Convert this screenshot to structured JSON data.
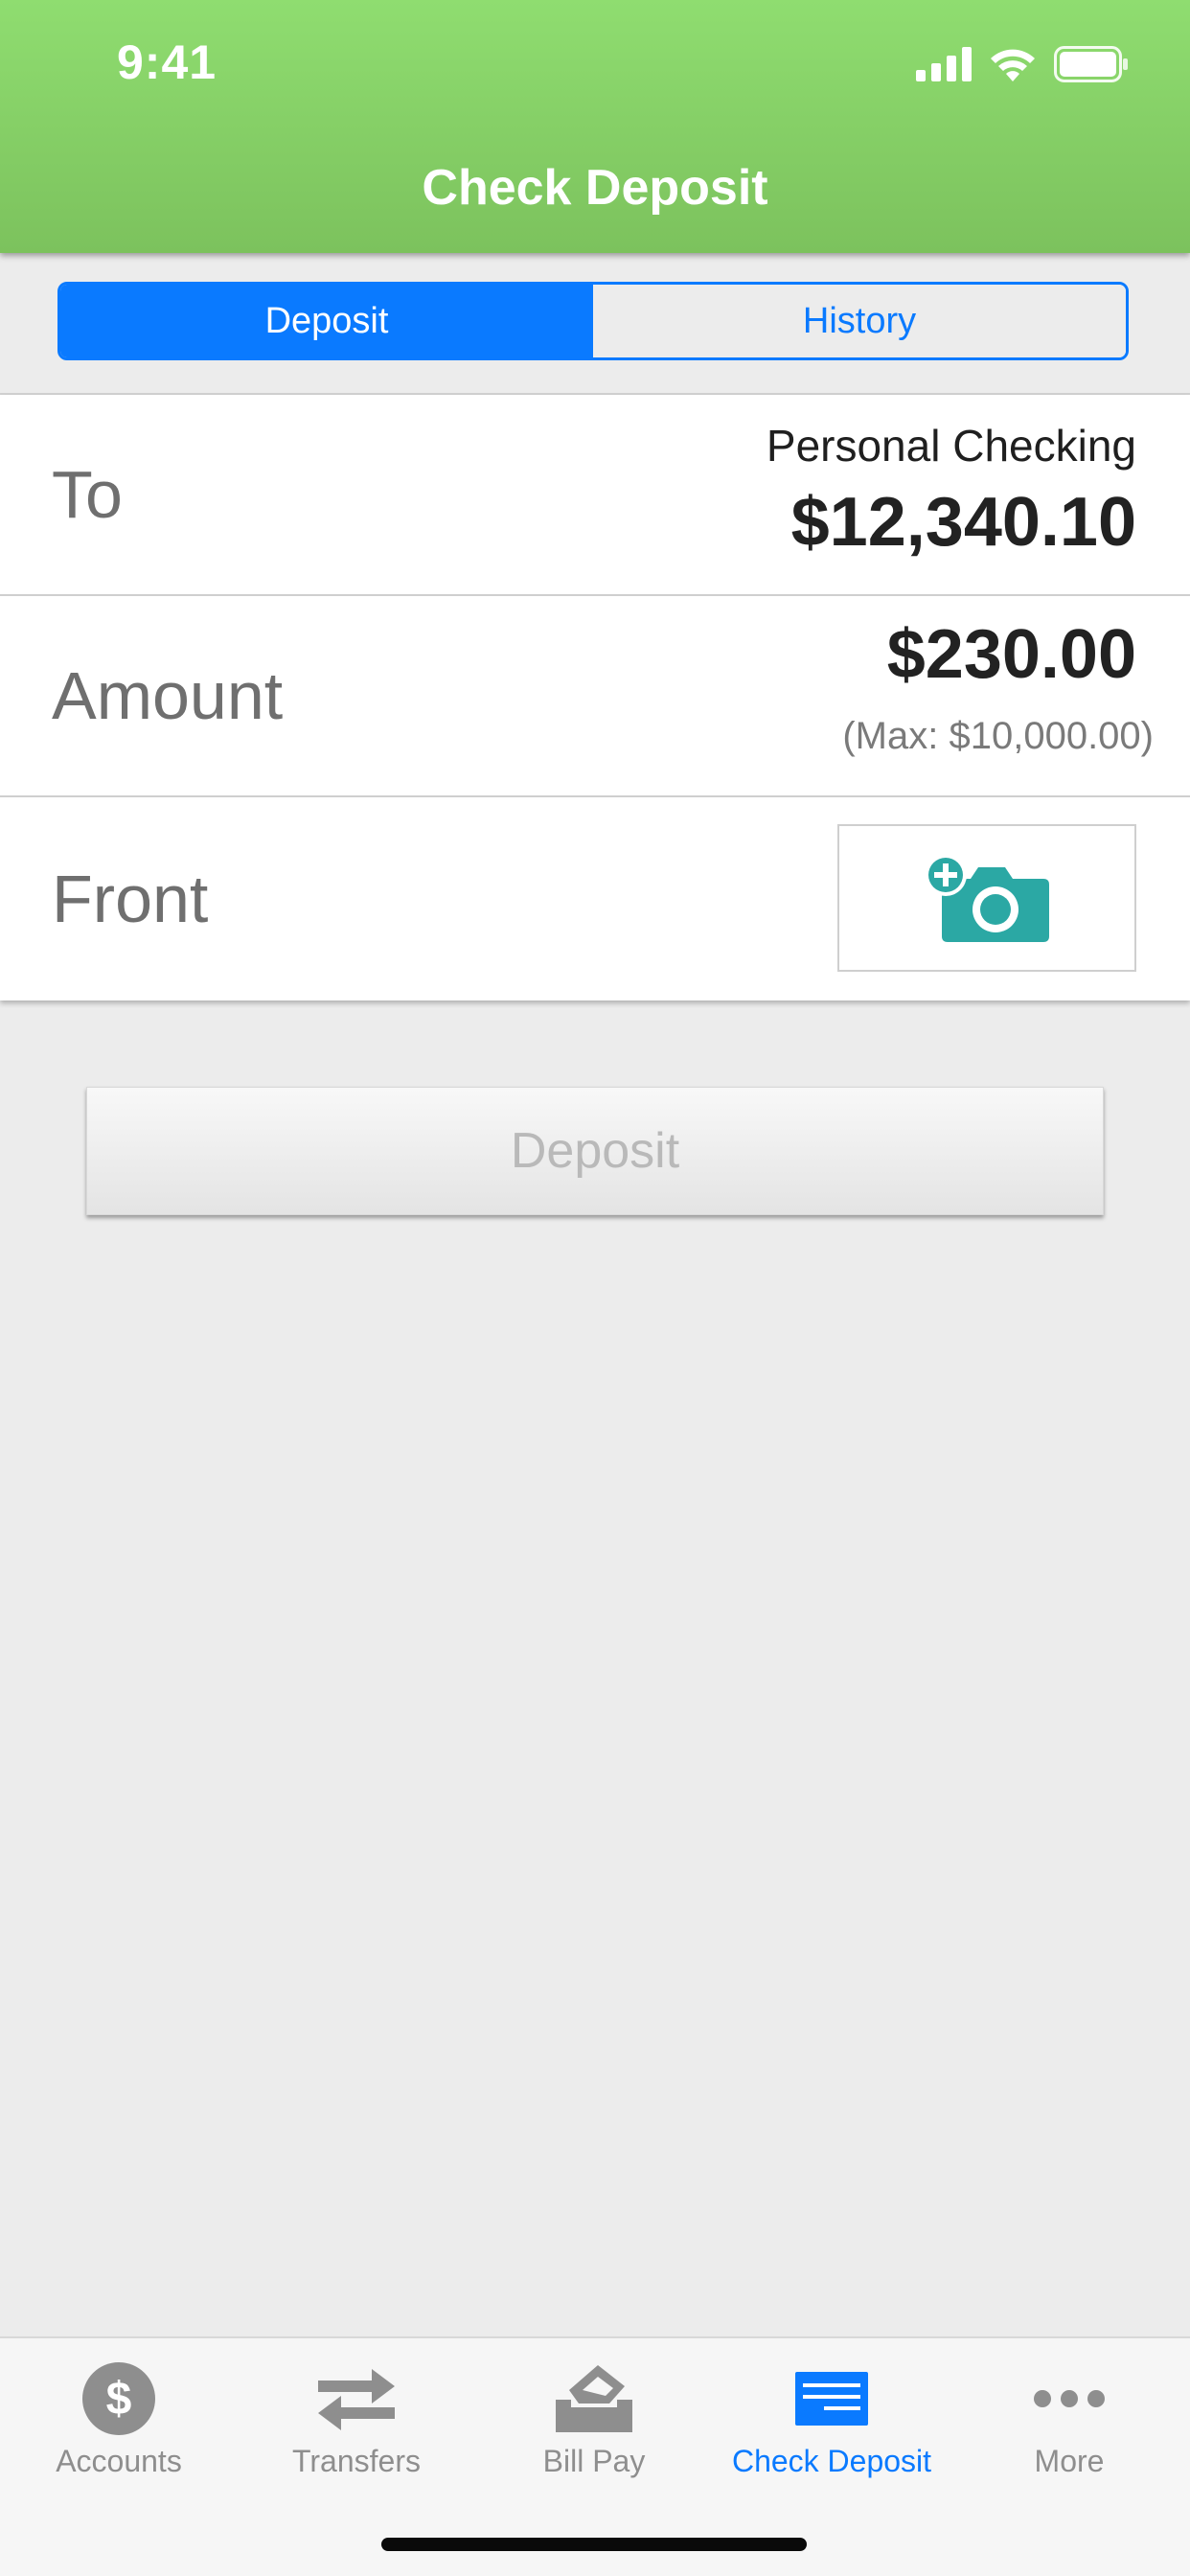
{
  "status_bar": {
    "time": "9:41"
  },
  "header": {
    "title": "Check Deposit",
    "accent_color": "#7cc25d"
  },
  "segment": {
    "tabs": [
      {
        "label": "Deposit",
        "selected": true
      },
      {
        "label": "History",
        "selected": false
      }
    ],
    "accent_color": "#0a7aff"
  },
  "form": {
    "to": {
      "label": "To",
      "account_name": "Personal Checking",
      "balance": "$12,340.10"
    },
    "amount": {
      "label": "Amount",
      "value": "$230.00",
      "max_note": "(Max: $10,000.00)"
    },
    "front": {
      "label": "Front",
      "icon": "add-camera-icon",
      "icon_color": "#2ba8a4"
    }
  },
  "deposit_button": {
    "label": "Deposit",
    "enabled": false
  },
  "tabbar": {
    "items": [
      {
        "label": "Accounts",
        "icon": "dollar-circle-icon",
        "active": false
      },
      {
        "label": "Transfers",
        "icon": "transfer-arrows-icon",
        "active": false
      },
      {
        "label": "Bill Pay",
        "icon": "bill-pay-icon",
        "active": false
      },
      {
        "label": "Check Deposit",
        "icon": "check-deposit-icon",
        "active": true
      },
      {
        "label": "More",
        "icon": "more-dots-icon",
        "active": false
      }
    ],
    "active_color": "#0a7aff",
    "inactive_color": "#8e8e8e"
  }
}
